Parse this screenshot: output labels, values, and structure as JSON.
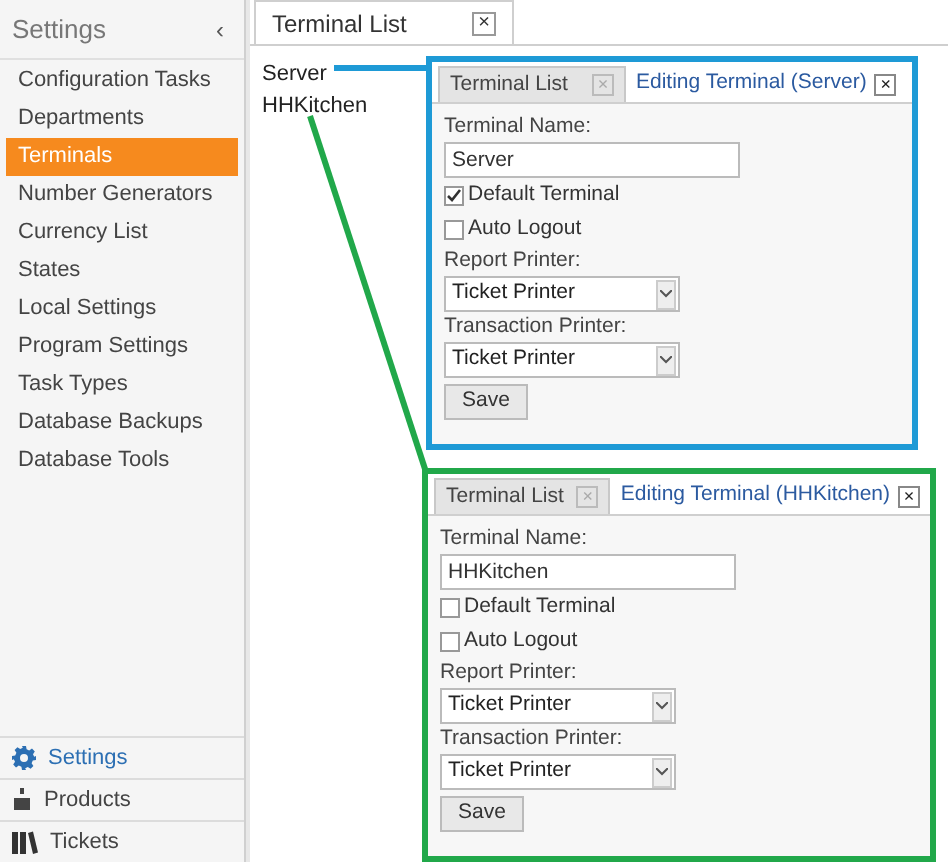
{
  "sidebar": {
    "title": "Settings",
    "collapse_glyph": "‹",
    "items": [
      {
        "label": "Configuration Tasks",
        "selected": false
      },
      {
        "label": "Departments",
        "selected": false
      },
      {
        "label": "Terminals",
        "selected": true
      },
      {
        "label": "Number Generators",
        "selected": false
      },
      {
        "label": "Currency List",
        "selected": false
      },
      {
        "label": "States",
        "selected": false
      },
      {
        "label": "Local Settings",
        "selected": false
      },
      {
        "label": "Program Settings",
        "selected": false
      },
      {
        "label": "Task Types",
        "selected": false
      },
      {
        "label": "Database Backups",
        "selected": false
      },
      {
        "label": "Database Tools",
        "selected": false
      }
    ],
    "sections": [
      {
        "label": "Settings",
        "kind": "gear",
        "selected": true
      },
      {
        "label": "Products",
        "kind": "cup",
        "selected": false
      },
      {
        "label": "Tickets",
        "kind": "books",
        "selected": false
      }
    ]
  },
  "main": {
    "tabs": [
      {
        "label": "Terminal List",
        "close": "×",
        "selected": true
      }
    ],
    "terminals": [
      "Server",
      "HHKitchen"
    ]
  },
  "callouts": [
    {
      "color": "#1e9ad6",
      "tabs": [
        {
          "label": "Terminal List",
          "close": "×",
          "selected": false
        },
        {
          "label": "Editing Terminal (Server)",
          "close": "×",
          "selected": true
        }
      ],
      "name_label": "Terminal Name:",
      "name_value": "Server",
      "checks": [
        {
          "label": "Default Terminal",
          "checked": true
        },
        {
          "label": "Auto Logout",
          "checked": false
        }
      ],
      "selects": [
        {
          "label": "Report Printer:",
          "value": "Ticket Printer"
        },
        {
          "label": "Transaction Printer:",
          "value": "Ticket Printer"
        }
      ],
      "save": "Save"
    },
    {
      "color": "#21a84a",
      "tabs": [
        {
          "label": "Terminal List",
          "close": "×",
          "selected": false
        },
        {
          "label": "Editing Terminal (HHKitchen)",
          "close": "×",
          "selected": true
        }
      ],
      "name_label": "Terminal Name:",
      "name_value": "HHKitchen",
      "checks": [
        {
          "label": "Default Terminal",
          "checked": false
        },
        {
          "label": "Auto Logout",
          "checked": false
        }
      ],
      "selects": [
        {
          "label": "Report Printer:",
          "value": "Ticket Printer"
        },
        {
          "label": "Transaction Printer:",
          "value": "Ticket Printer"
        }
      ],
      "save": "Save"
    }
  ]
}
